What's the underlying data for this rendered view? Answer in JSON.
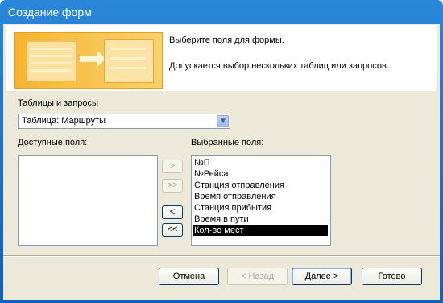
{
  "window": {
    "title": "Создание форм"
  },
  "header": {
    "line1": "Выберите поля для формы.",
    "line2": "Допускается выбор нескольких таблиц или запросов."
  },
  "tables": {
    "label": "Таблицы и запросы",
    "selected": "Таблица: Маршруты"
  },
  "available": {
    "label": "Доступные поля:",
    "items": []
  },
  "selected_fields": {
    "label": "Выбранные поля:",
    "items": [
      "№П",
      "№Рейса",
      "Станция отправления",
      "Время отправления",
      "Станция прибытия",
      "Время в пути",
      "Кол-во мест"
    ],
    "highlighted": "Кол-во мест"
  },
  "move_buttons": {
    "add": ">",
    "add_all": ">>",
    "remove": "<",
    "remove_all": "<<"
  },
  "footer": {
    "cancel": "Отмена",
    "back": "< Назад",
    "next": "Далее >",
    "finish": "Готово"
  },
  "colors": {
    "title_bar": "#0f5fc0",
    "dialog_bg": "#ece9d8",
    "illustration": "#f7b431"
  }
}
